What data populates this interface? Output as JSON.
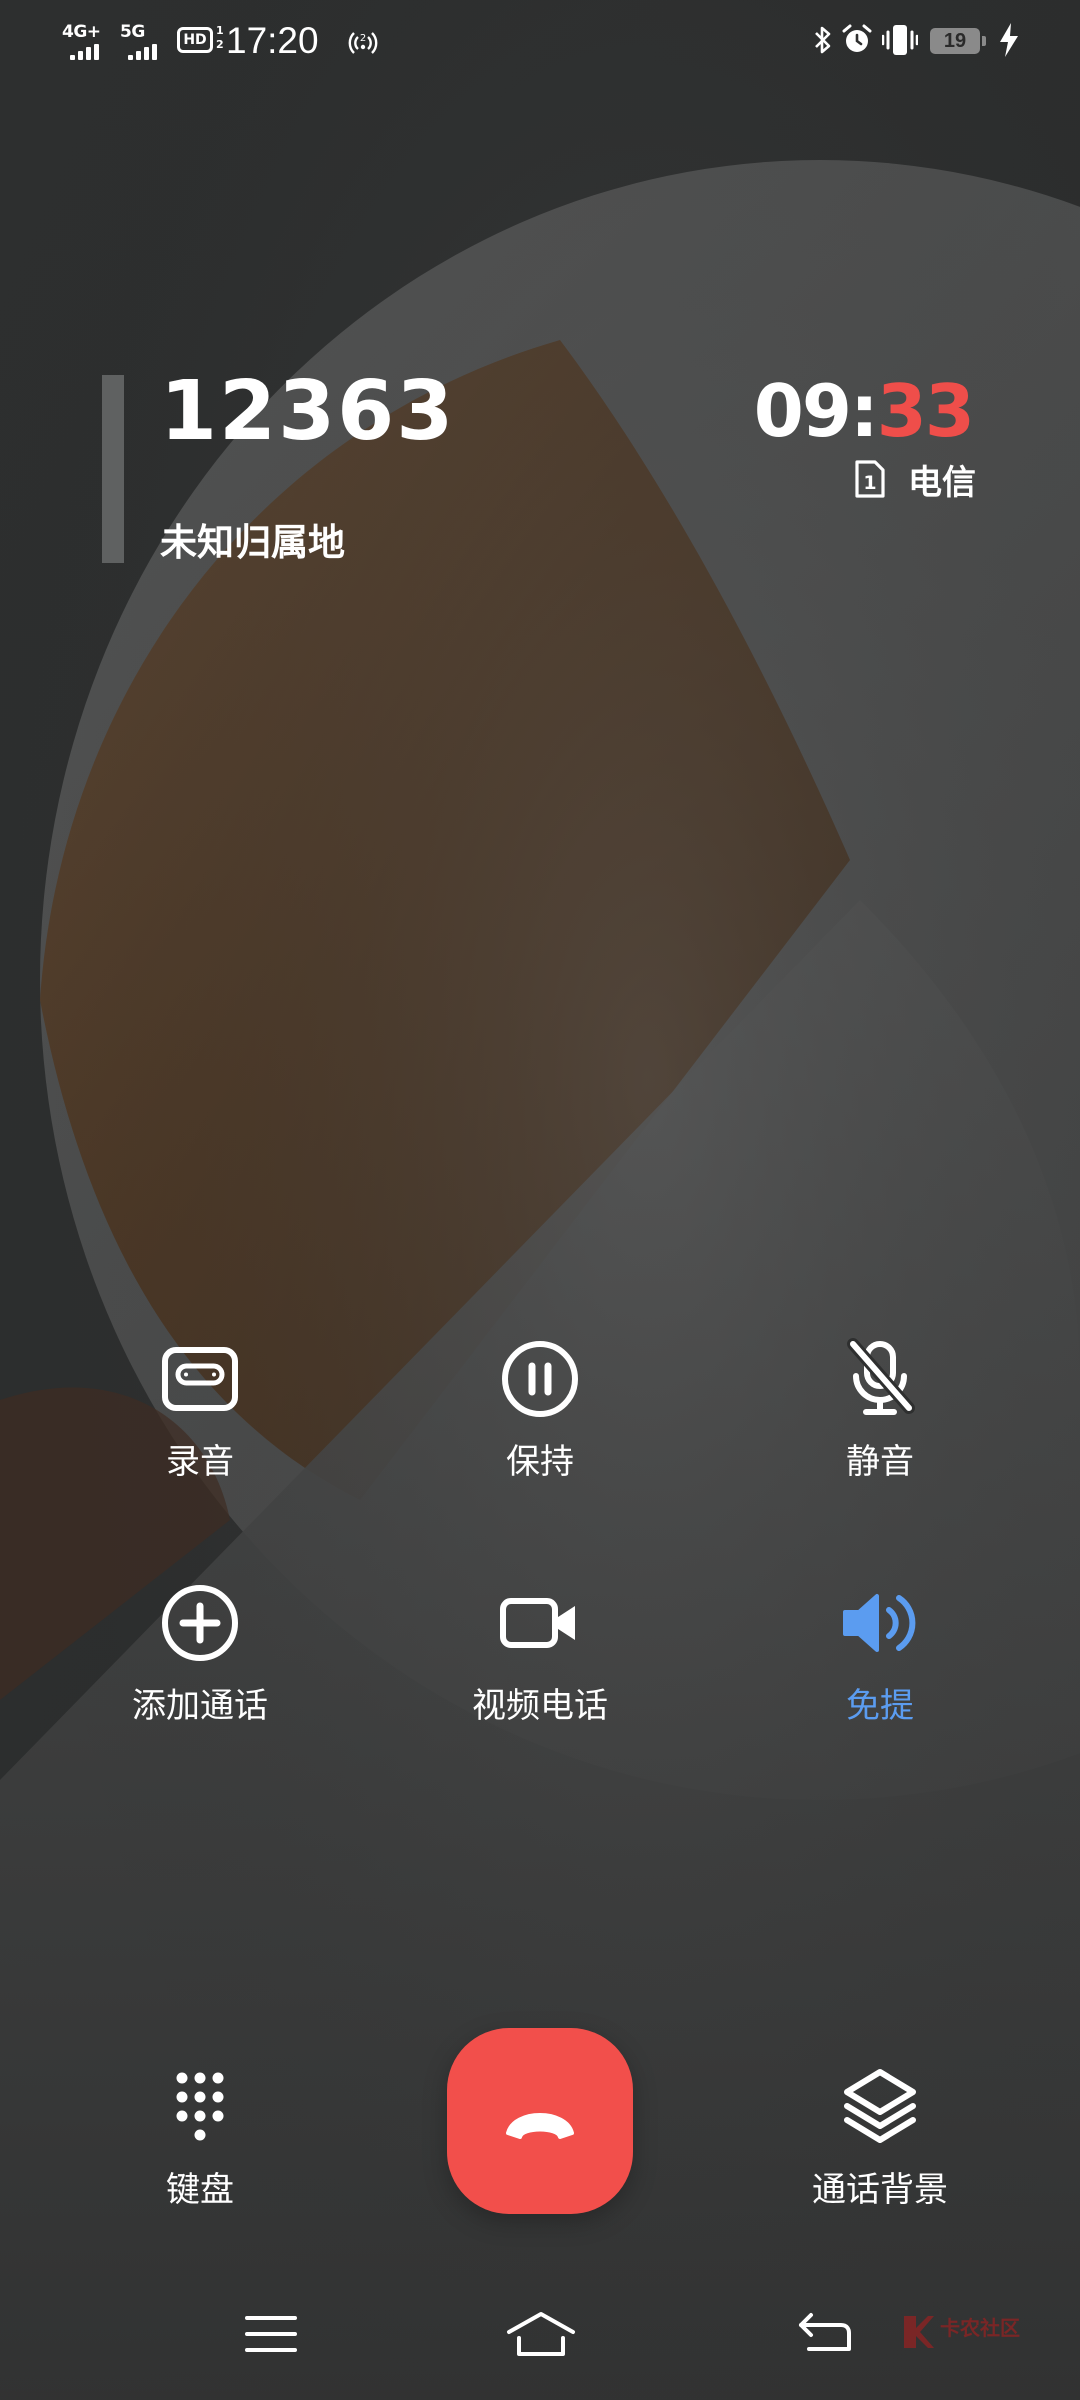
{
  "status_bar": {
    "net1": "4G+",
    "net2": "5G",
    "hd_badge": "HD",
    "hd_sub_top": "1",
    "hd_sub_bottom": "2",
    "time": "17:20",
    "battery_level": "19",
    "icons": [
      "signal-icon",
      "hd-voice-icon",
      "hotspot-icon",
      "bluetooth-icon",
      "alarm-icon",
      "vibrate-icon",
      "battery-icon",
      "charging-icon"
    ]
  },
  "caller": {
    "number": "12363",
    "location": "未知归属地"
  },
  "call": {
    "timer_minutes": "09",
    "timer_separator": ":",
    "timer_seconds": "33",
    "sim_slot": "1",
    "carrier": "电信"
  },
  "actions": {
    "record": {
      "label": "录音",
      "icon": "cassette-icon"
    },
    "hold": {
      "label": "保持",
      "icon": "pause-icon"
    },
    "mute": {
      "label": "静音",
      "icon": "mic-off-icon"
    },
    "add_call": {
      "label": "添加通话",
      "icon": "plus-circle-icon"
    },
    "video_call": {
      "label": "视频电话",
      "icon": "video-icon"
    },
    "speaker": {
      "label": "免提",
      "icon": "speaker-icon",
      "active": true
    }
  },
  "bottom": {
    "keypad": {
      "label": "键盘",
      "icon": "keypad-icon"
    },
    "end_call": {
      "icon": "hang-up-icon"
    },
    "background": {
      "label": "通话背景",
      "icon": "layers-icon"
    }
  },
  "nav": {
    "items": [
      "menu-icon",
      "home-icon",
      "back-icon"
    ]
  },
  "watermark": {
    "text": "卡农社区"
  },
  "colors": {
    "accent_active": "#5b9cf0",
    "end_call": "#f24f4b",
    "timer_seconds": "#ef4e4a",
    "background": "#2e2f2f"
  }
}
